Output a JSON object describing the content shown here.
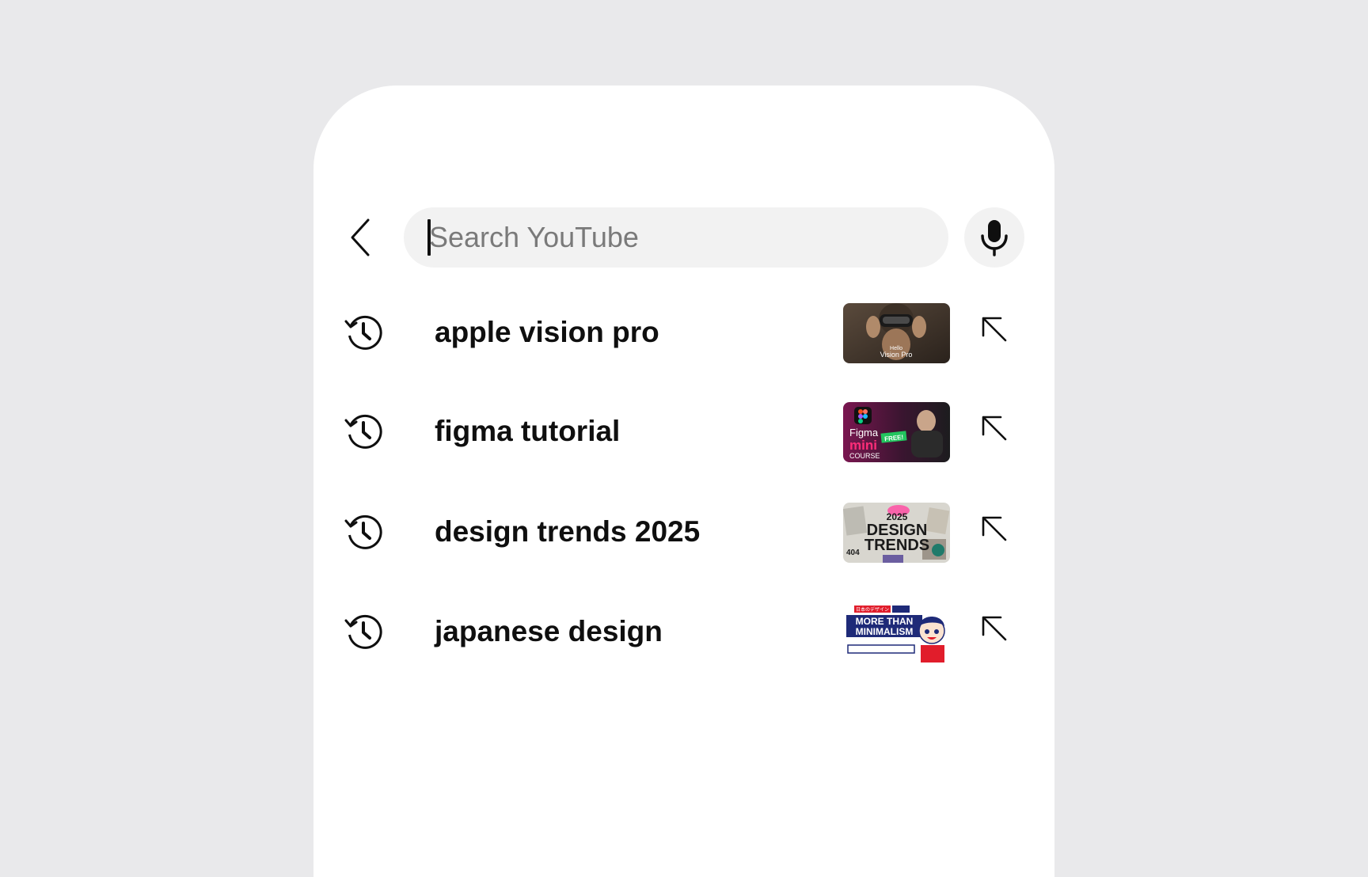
{
  "search": {
    "placeholder": "Search YouTube",
    "value": ""
  },
  "icons": {
    "back": "chevron-left-icon",
    "mic": "microphone-icon",
    "history": "history-icon",
    "fill": "arrow-up-left-icon"
  },
  "suggestions": [
    {
      "label": "apple vision pro",
      "thumb_text_1": "Hello",
      "thumb_text_2": "Vision Pro"
    },
    {
      "label": "figma tutorial",
      "thumb_text_1": "Figma",
      "thumb_text_2": "mini",
      "thumb_text_3": "COURSE",
      "thumb_text_4": "FREE!"
    },
    {
      "label": "design trends 2025",
      "thumb_text_1": "2025",
      "thumb_text_2": "DESIGN",
      "thumb_text_3": "TRENDS",
      "thumb_text_4": "404"
    },
    {
      "label": "japanese design",
      "thumb_text_1": "MORE THAN",
      "thumb_text_2": "MINIMALISM",
      "thumb_text_3": "日本のデザイン"
    }
  ],
  "colors": {
    "page_bg": "#e9e9eb",
    "surface": "#ffffff",
    "field_bg": "#f2f2f2",
    "text": "#0f0f0f",
    "placeholder": "#7a7a7a"
  }
}
